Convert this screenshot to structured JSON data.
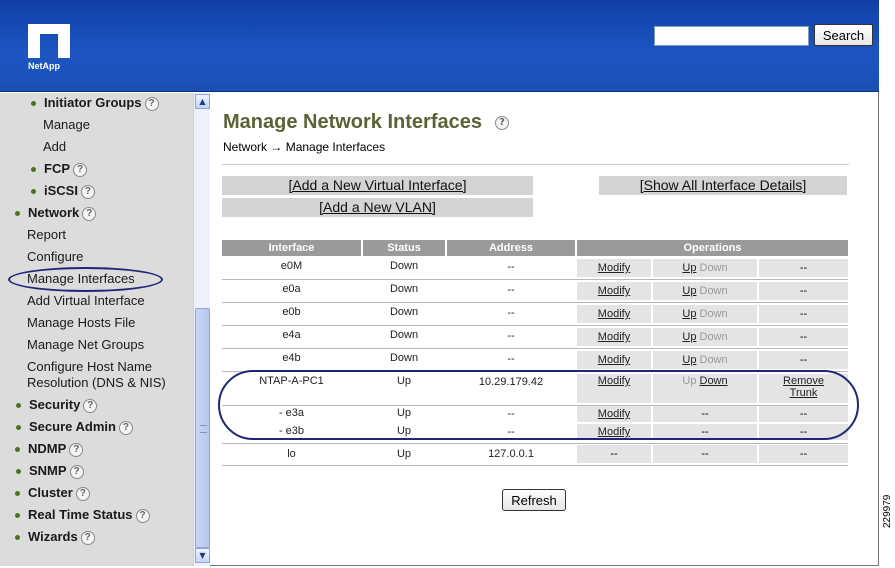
{
  "header": {
    "logo_text": "NetApp",
    "search_placeholder": "",
    "search_button": "Search"
  },
  "sidebar": {
    "items": [
      {
        "label": "Initiator Groups",
        "help": true,
        "bold": true,
        "bullet": true
      },
      {
        "label": "Manage"
      },
      {
        "label": "Add"
      },
      {
        "label": "FCP",
        "help": true,
        "bold": true,
        "bullet": true
      },
      {
        "label": "iSCSI",
        "help": true,
        "bold": true,
        "bullet": true
      },
      {
        "label": "Network",
        "help": true,
        "bold": true,
        "bullet": true
      },
      {
        "label": "Report"
      },
      {
        "label": "Configure"
      },
      {
        "label": "Manage Interfaces",
        "selected": true
      },
      {
        "label": "Add Virtual Interface"
      },
      {
        "label": "Manage Hosts File"
      },
      {
        "label": "Manage Net Groups"
      },
      {
        "label": "Configure Host Name"
      },
      {
        "label": "Resolution (DNS & NIS)"
      },
      {
        "label": "Security",
        "help": true,
        "bold": true,
        "bullet": true
      },
      {
        "label": "Secure Admin",
        "help": true,
        "bold": true,
        "bullet": true
      },
      {
        "label": "NDMP",
        "help": true,
        "bold": true,
        "bullet": true
      },
      {
        "label": "SNMP",
        "help": true,
        "bold": true,
        "bullet": true
      },
      {
        "label": "Cluster",
        "help": true,
        "bold": true,
        "bullet": true
      },
      {
        "label": "Real Time Status",
        "help": true,
        "bold": true,
        "bullet": true
      },
      {
        "label": "Wizards",
        "help": true,
        "bold": true,
        "bullet": true
      }
    ],
    "help_glyph": "?"
  },
  "main": {
    "title": "Manage Network Interfaces",
    "breadcrumb": {
      "parent": "Network",
      "arrow": "→",
      "current": "Manage Interfaces"
    },
    "links": {
      "add_virtual": "[Add a New Virtual Interface]",
      "add_vlan": "[Add a New VLAN]",
      "show_all": "[Show All Interface Details]"
    },
    "table": {
      "headers": [
        "Interface",
        "Status",
        "Address",
        "Operations"
      ],
      "rows": [
        {
          "iface": "e0M",
          "status": "Down",
          "address": "--",
          "op1": "Modify",
          "up": "Up",
          "down": "Down",
          "op3": "--"
        },
        {
          "iface": "e0a",
          "status": "Down",
          "address": "--",
          "op1": "Modify",
          "up": "Up",
          "down": "Down",
          "op3": "--"
        },
        {
          "iface": "e0b",
          "status": "Down",
          "address": "--",
          "op1": "Modify",
          "up": "Up",
          "down": "Down",
          "op3": "--"
        },
        {
          "iface": "e4a",
          "status": "Down",
          "address": "--",
          "op1": "Modify",
          "up": "Up",
          "down": "Down",
          "op3": "--"
        },
        {
          "iface": "e4b",
          "status": "Down",
          "address": "--",
          "op1": "Modify",
          "up": "Up",
          "down": "Down",
          "op3": "--"
        }
      ],
      "trunk": {
        "iface": "NTAP-A-PC1",
        "status": "Up",
        "address": "10.29.179.42",
        "op1": "Modify",
        "up": "Up",
        "down": "Down",
        "remove1": "Remove",
        "remove2": "Trunk"
      },
      "members": [
        {
          "iface": "-  e3a",
          "status": "Up",
          "address": "--",
          "op1": "Modify",
          "op2": "--",
          "op3": "--"
        },
        {
          "iface": "-  e3b",
          "status": "Up",
          "address": "--",
          "op1": "Modify",
          "op2": "--",
          "op3": "--"
        }
      ],
      "lo": {
        "iface": "lo",
        "status": "Up",
        "address": "127.0.0.1",
        "op1": "--",
        "op2": "--",
        "op3": "--"
      }
    },
    "refresh_button": "Refresh"
  },
  "figure_id": "229979",
  "colors": {
    "header_blue": "#1a50b8",
    "title_olive": "#5b6336",
    "annotation_navy": "#1c2877",
    "sidebar_gray": "#dcdcdc"
  }
}
